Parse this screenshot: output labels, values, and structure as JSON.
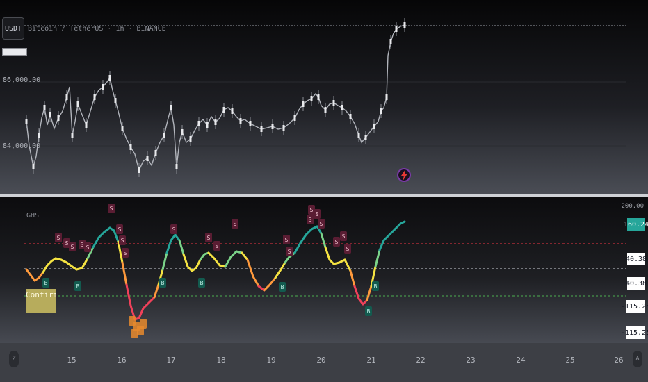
{
  "symbol": {
    "badge_text": "USDT",
    "title": "Bitcoin / TetherUS · 1h · BINANCE"
  },
  "price_axis": {
    "labels": [
      "86,000.00",
      "84,000.00"
    ]
  },
  "indicator": {
    "name": "GHS",
    "top_axis_label": "200.00"
  },
  "value_tags": {
    "current": "160.24",
    "upper_1": "40.38",
    "upper_2": "40.38",
    "lower_1": "-115.25",
    "lower_2": "-115.25"
  },
  "confirmed_label": {
    "text": "Confirmed Bullish"
  },
  "time_axis": {
    "days": [
      "15",
      "16",
      "17",
      "18",
      "19",
      "20",
      "21",
      "22",
      "23",
      "24",
      "25",
      "26"
    ],
    "left_button": "Z",
    "right_button": "A"
  },
  "signals": {
    "sell_letter": "S",
    "buy_letter": "B"
  },
  "colors": {
    "sell_marker": "#5a1d33",
    "buy_marker": "#135b4f",
    "teal": "#26a69a",
    "oversold_line": "#4caf50",
    "overbought_line": "#f23645",
    "mid_line": "#d1d4dc",
    "price_line": "#b2b5bc",
    "lightning_icon": "#e53935"
  },
  "icons": {
    "lightning": "lightning-icon"
  }
}
